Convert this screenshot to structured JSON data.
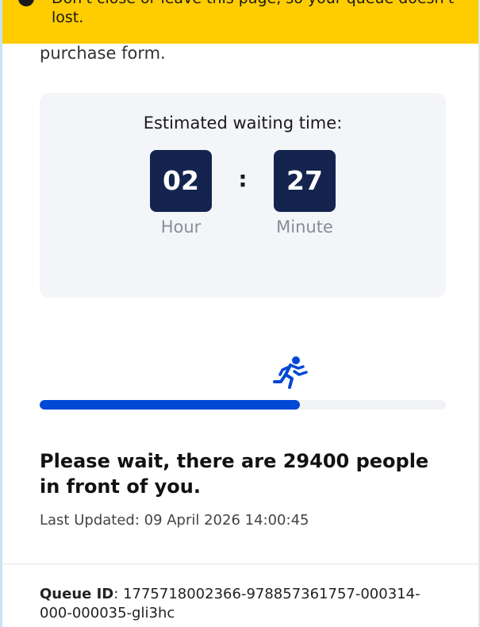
{
  "banner": {
    "text": "Don't close or leave this page, so your queue doesn't lost.",
    "icon": "info-icon",
    "color": "#ffcc00"
  },
  "intro": {
    "text": "purchase form."
  },
  "wait_card": {
    "title": "Estimated waiting time:",
    "hours": "02",
    "minutes": "27",
    "separator": ":",
    "hour_label": "Hour",
    "minute_label": "Minute",
    "box_color": "#14244f"
  },
  "progress": {
    "icon": "running-person-icon",
    "fraction": 0.64,
    "fill_color": "#0048d6"
  },
  "status": {
    "message": "Please wait, there are 29400 people in front of you.",
    "last_updated": "Last Updated: 09 April 2026 14:00:45"
  },
  "queue": {
    "label": "Queue ID",
    "separator": ":",
    "id": " 1775718002366-978857361757-000314-000-000035-gli3hc"
  }
}
